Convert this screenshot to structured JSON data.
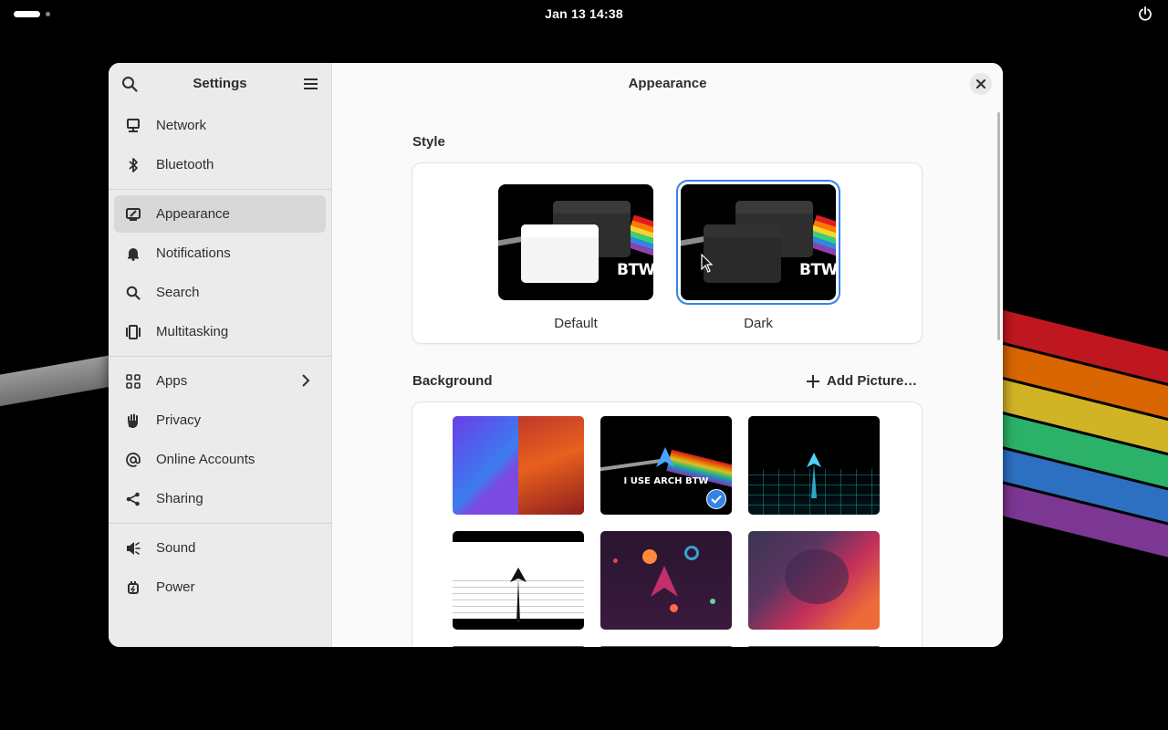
{
  "topbar": {
    "clock": "Jan 13  14:38",
    "power_icon": "power-icon"
  },
  "sidebar": {
    "title": "Settings",
    "search_icon": "search-icon",
    "menu_icon": "hamburger-menu-icon",
    "groups": [
      [
        {
          "label": "Network",
          "icon": "network-icon"
        },
        {
          "label": "Bluetooth",
          "icon": "bluetooth-icon"
        }
      ],
      [
        {
          "label": "Appearance",
          "icon": "appearance-icon",
          "active": true
        },
        {
          "label": "Notifications",
          "icon": "bell-icon"
        },
        {
          "label": "Search",
          "icon": "search-icon"
        },
        {
          "label": "Multitasking",
          "icon": "multitasking-icon"
        }
      ],
      [
        {
          "label": "Apps",
          "icon": "apps-grid-icon",
          "has_chevron": true
        },
        {
          "label": "Privacy",
          "icon": "hand-icon"
        },
        {
          "label": "Online Accounts",
          "icon": "at-icon"
        },
        {
          "label": "Sharing",
          "icon": "share-icon"
        }
      ],
      [
        {
          "label": "Sound",
          "icon": "speaker-icon"
        },
        {
          "label": "Power",
          "icon": "power-plug-icon"
        }
      ]
    ]
  },
  "content": {
    "title": "Appearance",
    "style": {
      "label": "Style",
      "options": [
        {
          "name": "Default",
          "selected": false,
          "thumb_text": "BTW"
        },
        {
          "name": "Dark",
          "selected": true,
          "thumb_text": "BTW"
        }
      ]
    },
    "background": {
      "label": "Background",
      "add_label": "Add Picture…",
      "thumbnails": [
        {
          "name": "blue-red-crystals"
        },
        {
          "name": "i-use-arch-btw",
          "text": "I USE ARCH BTW",
          "selected": true
        },
        {
          "name": "arch-neon-grid"
        },
        {
          "name": "arch-white-road"
        },
        {
          "name": "arch-space-planets"
        },
        {
          "name": "purple-red-waves"
        }
      ]
    }
  },
  "colors": {
    "accent": "#3584e4",
    "sidebar_bg": "#ebebeb",
    "content_bg": "#fafafa",
    "rainbow": [
      "#e01b24",
      "#ff7800",
      "#f6d32d",
      "#33d17a",
      "#3584e4",
      "#9141ac"
    ]
  }
}
